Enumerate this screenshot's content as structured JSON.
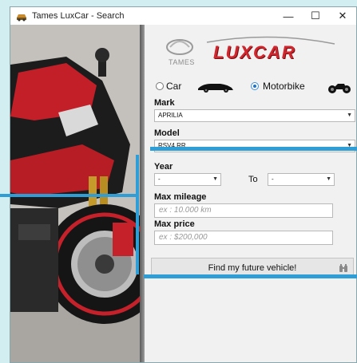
{
  "window": {
    "title": "Tames LuxCar - Search",
    "minimize": "—",
    "maximize": "☐",
    "close": "✕"
  },
  "logo": {
    "small_text": "TAMES",
    "brand": "LUXCAR"
  },
  "vehicle_type": {
    "car_label": "Car",
    "motorbike_label": "Motorbike",
    "selected": "Motorbike"
  },
  "mark": {
    "label": "Mark",
    "value": "APRILIA"
  },
  "model": {
    "label": "Model",
    "value": "RSV4 RR"
  },
  "year": {
    "label": "Year",
    "from_value": "-",
    "to_label": "To",
    "to_value": "-"
  },
  "max_mileage": {
    "label": "Max mileage",
    "placeholder": "ex : 10.000 km"
  },
  "max_price": {
    "label": "Max price",
    "placeholder": "ex : $200,000"
  },
  "find_button": {
    "label": "Find my future vehicle!"
  },
  "colors": {
    "accent": "#2f9ed6",
    "brand_red": "#d0262e"
  }
}
